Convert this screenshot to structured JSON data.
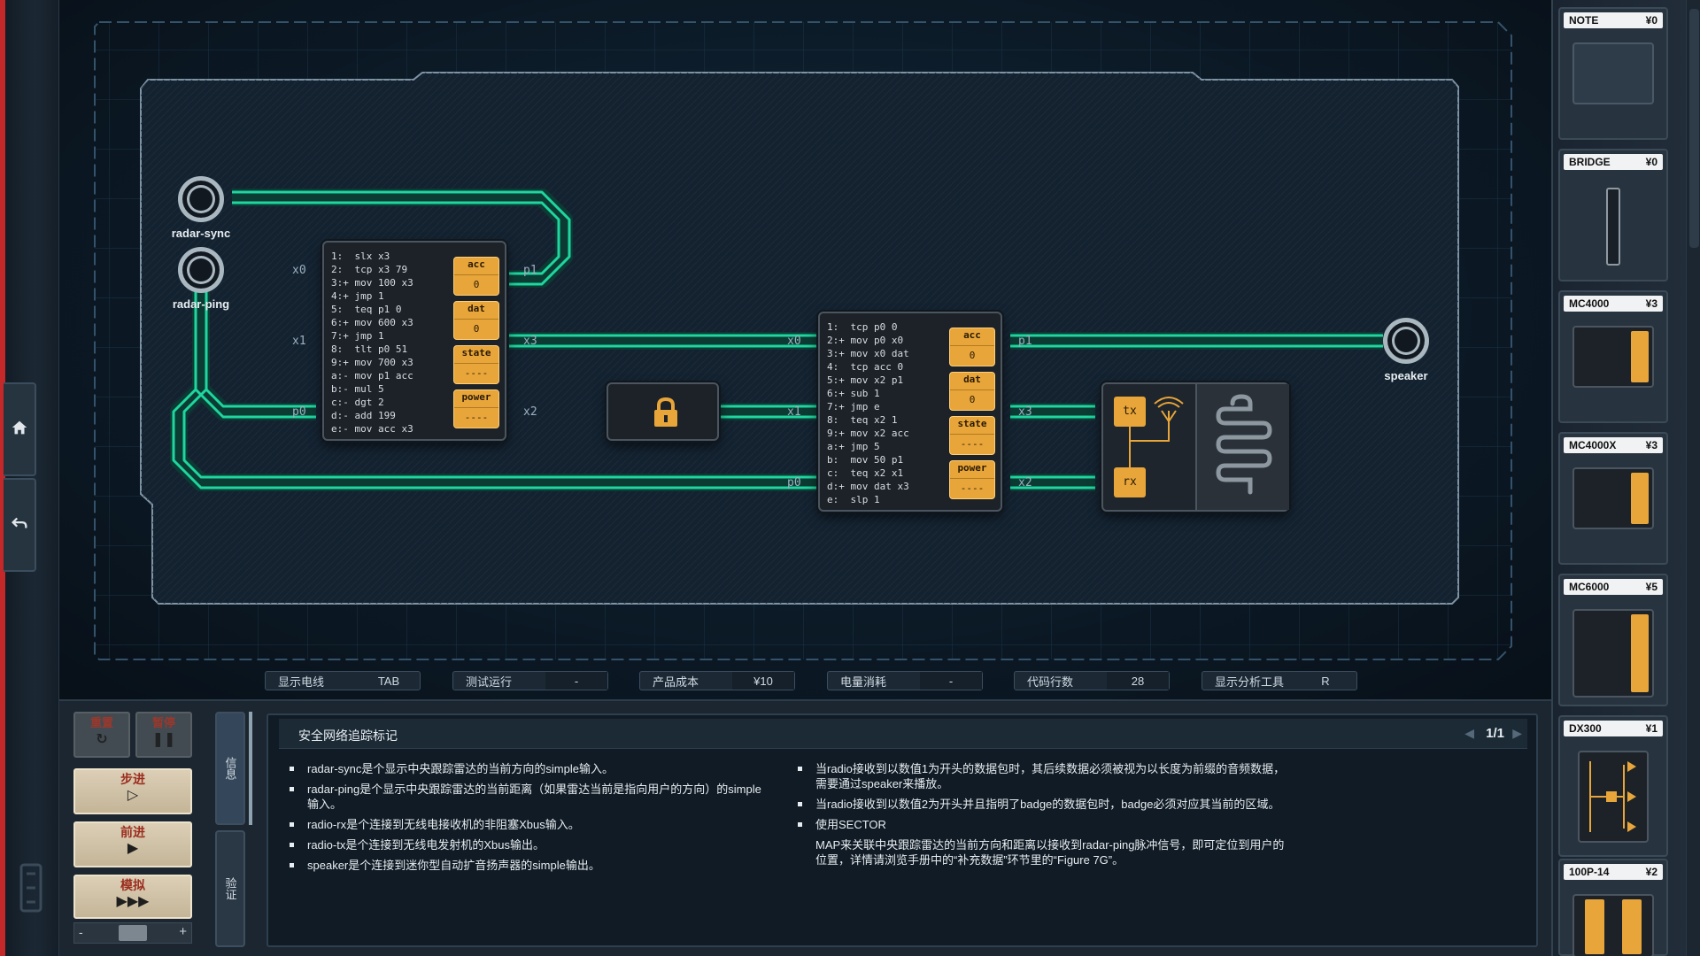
{
  "board": {
    "ports": {
      "radar_sync": "radar-sync",
      "radar_ping": "radar-ping",
      "speaker": "speaker"
    },
    "chip1": {
      "code": "1:  slx x3\n2:  tcp x3 79\n3:+ mov 100 x3\n4:+ jmp 1\n5:  teq p1 0\n6:+ mov 600 x3\n7:+ jmp 1\n8:  tlt p0 51\n9:+ mov 700 x3\na:- mov p1 acc\nb:- mul 5\nc:- dgt 2\nd:- add 199\ne:- mov acc x3",
      "pins_left": [
        "x0",
        "x1",
        "p0"
      ],
      "pins_right": [
        "p1",
        "x3",
        "x2"
      ],
      "registers": [
        {
          "name": "acc",
          "value": "0"
        },
        {
          "name": "dat",
          "value": "0"
        },
        {
          "name": "state",
          "value": "----"
        },
        {
          "name": "power",
          "value": "----"
        }
      ]
    },
    "chip2": {
      "code": "1:  tcp p0 0\n2:+ mov p0 x0\n3:+ mov x0 dat\n4:  tcp acc 0\n5:+ mov x2 p1\n6:+ sub 1\n7:+ jmp e\n8:  teq x2 1\n9:+ mov x2 acc\na:+ jmp 5\nb:  mov 50 p1\nc:  teq x2 x1\nd:+ mov dat x3\ne:  slp 1",
      "pins_left": [
        "x0",
        "x1",
        "p0"
      ],
      "pins_right": [
        "p1",
        "x3",
        "x2"
      ],
      "registers": [
        {
          "name": "acc",
          "value": "0"
        },
        {
          "name": "dat",
          "value": "0"
        },
        {
          "name": "state",
          "value": "----"
        },
        {
          "name": "power",
          "value": "----"
        }
      ]
    },
    "radio": {
      "tx": "tx",
      "rx": "rx"
    },
    "wire_color": "#1fd6a0"
  },
  "status_bar": {
    "show_wires": {
      "label": "显示电线",
      "key": "TAB"
    },
    "test_run": {
      "label": "测试运行",
      "value": "-"
    },
    "product_cost": {
      "label": "产品成本",
      "value": "¥10"
    },
    "power_usage": {
      "label": "电量消耗",
      "value": "-"
    },
    "code_lines": {
      "label": "代码行数",
      "value": "28"
    },
    "analyzer": {
      "label": "显示分析工具",
      "key": "R"
    }
  },
  "controls": {
    "reset": "重置",
    "pause": "暂停",
    "step": "步进",
    "advance": "前进",
    "simulate": "模拟",
    "minus": "-",
    "plus": "+"
  },
  "tabs": {
    "info": "信息",
    "verify": "验证"
  },
  "info": {
    "title": "安全网络追踪标记",
    "pager": "1/1",
    "left_items": [
      "radar-sync是个显示中央跟踪雷达的当前方向的simple输入。",
      "radar-ping是个显示中央跟踪雷达的当前距离（如果雷达当前是指向用户的方向）的simple输入。",
      "radio-rx是个连接到无线电接收机的非阻塞Xbus输入。",
      "radio-tx是个连接到无线电发射机的Xbus输出。",
      "speaker是个连接到迷你型自动扩音扬声器的simple输出。"
    ],
    "right_items": [
      "当radio接收到以数值1为开头的数据包时，其后续数据必须被视为以长度为前缀的音频数据，需要通过speaker来播放。",
      "当radio接收到以数值2为开头并且指明了badge的数据包时，badge必须对应其当前的区域。",
      "使用SECTOR"
    ],
    "right_paragraph": "MAP来关联中央跟踪雷达的当前方向和距离以接收到radar-ping脉冲信号，即可定位到用户的位置，详情请浏览手册中的“补充数据”环节里的“Figure 7G”。"
  },
  "parts": [
    {
      "name": "NOTE",
      "price": "¥0"
    },
    {
      "name": "BRIDGE",
      "price": "¥0"
    },
    {
      "name": "MC4000",
      "price": "¥3"
    },
    {
      "name": "MC4000X",
      "price": "¥3"
    },
    {
      "name": "MC6000",
      "price": "¥5"
    },
    {
      "name": "DX300",
      "price": "¥1"
    },
    {
      "name": "100P-14",
      "price": "¥2"
    }
  ]
}
